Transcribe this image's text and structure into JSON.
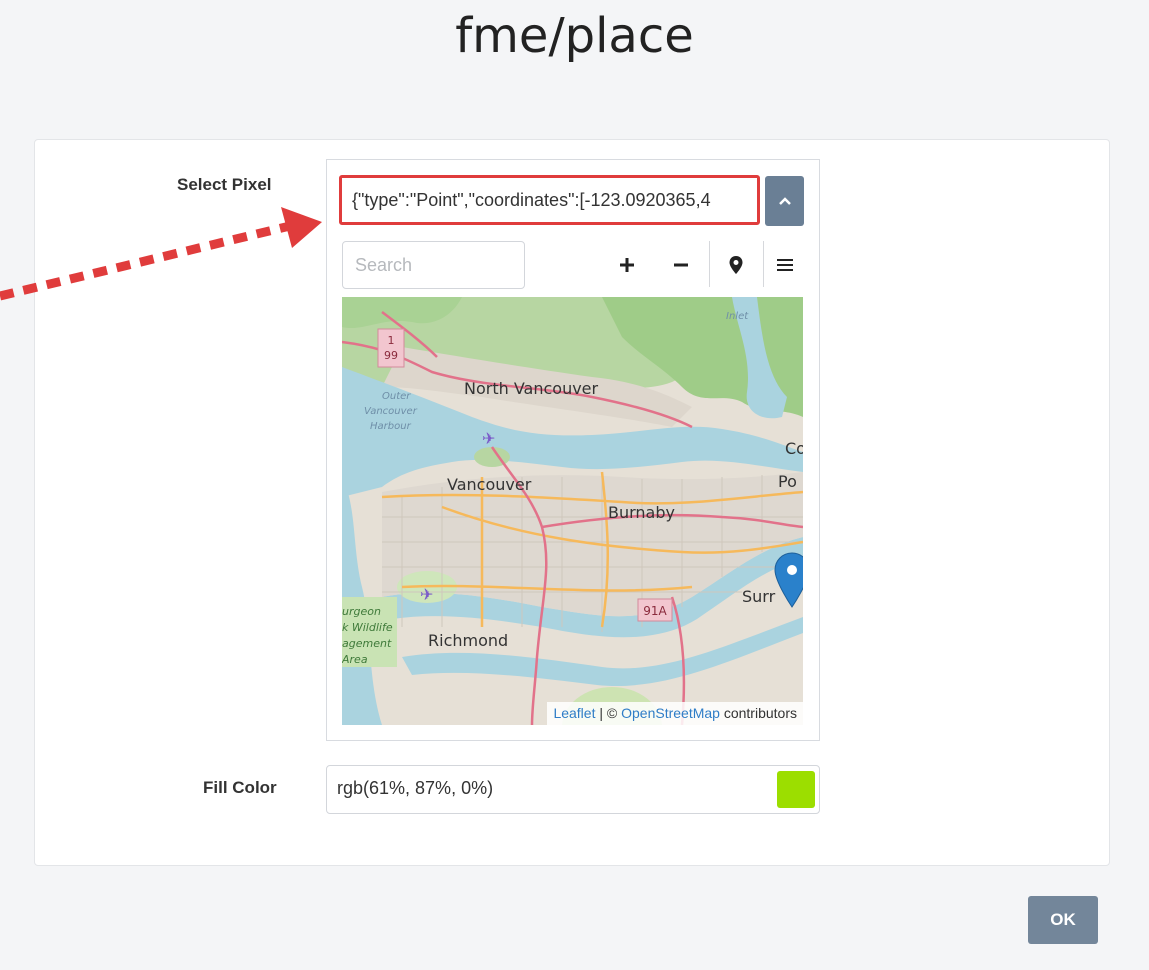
{
  "page_title": "fme/place",
  "form": {
    "select_pixel_label": "Select Pixel",
    "geometry_value": "{\"type\":\"Point\",\"coordinates\":[-123.0920365,4",
    "search_placeholder": "Search",
    "map_labels": {
      "north_vancouver": "North Vancouver",
      "vancouver": "Vancouver",
      "burnaby": "Burnaby",
      "richmond": "Richmond",
      "surrey": "Surr",
      "coq": "Co",
      "port": "Po",
      "outer_harbour_1": "Outer",
      "outer_harbour_2": "Vancouver",
      "outer_harbour_3": "Harbour",
      "wildlife_1": "urgeon",
      "wildlife_2": "k Wildlife",
      "wildlife_3": "agement",
      "wildlife_4": "Area",
      "inlet": "Inlet",
      "hwy_1_top": "1",
      "hwy_1_bottom": "99",
      "hwy_91a": "91A"
    },
    "attribution": {
      "leaflet": "Leaflet",
      "separator": " | © ",
      "osm": "OpenStreetMap",
      "contributors": " contributors"
    },
    "fill_color_label": "Fill Color",
    "fill_color_value": "rgb(61%, 87%, 0%)",
    "fill_color_swatch": "#9cde00"
  },
  "ok_label": "OK",
  "colors": {
    "highlight": "#e03c3c",
    "button": "#73869a",
    "marker": "#2a81cb"
  },
  "icons": {
    "collapse": "chevron-up-icon",
    "zoom_in": "plus-icon",
    "zoom_out": "minus-icon",
    "place_point": "map-pin-icon",
    "menu": "hamburger-menu-icon",
    "marker": "map-marker-icon",
    "airport": "airplane-icon"
  }
}
